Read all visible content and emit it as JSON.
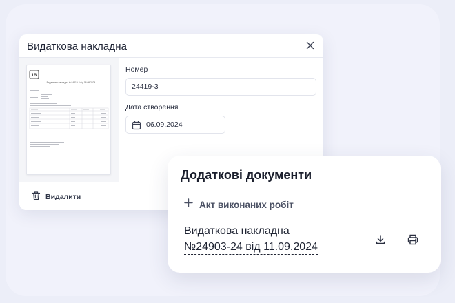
{
  "modal": {
    "title": "Видаткова накладна",
    "number_label": "Номер",
    "number_value": "24419-3",
    "date_label": "Дата створення",
    "date_value": "06.09.2024",
    "delete_label": "Видалити",
    "thumbnail": {
      "logo": "1B",
      "heading": "Видаткова накладна №24419-3 від 06.09.2024"
    }
  },
  "docs_card": {
    "title": "Додаткові документи",
    "add_act_label": "Акт виконаних робіт",
    "entry_line1": "Видаткова накладна",
    "entry_line2": "№24903-24 від 11.09.2024"
  },
  "icons": {
    "close": "close-icon",
    "calendar": "calendar-icon",
    "trash": "trash-icon",
    "plus": "plus-icon",
    "download": "download-icon",
    "print": "printer-icon"
  }
}
